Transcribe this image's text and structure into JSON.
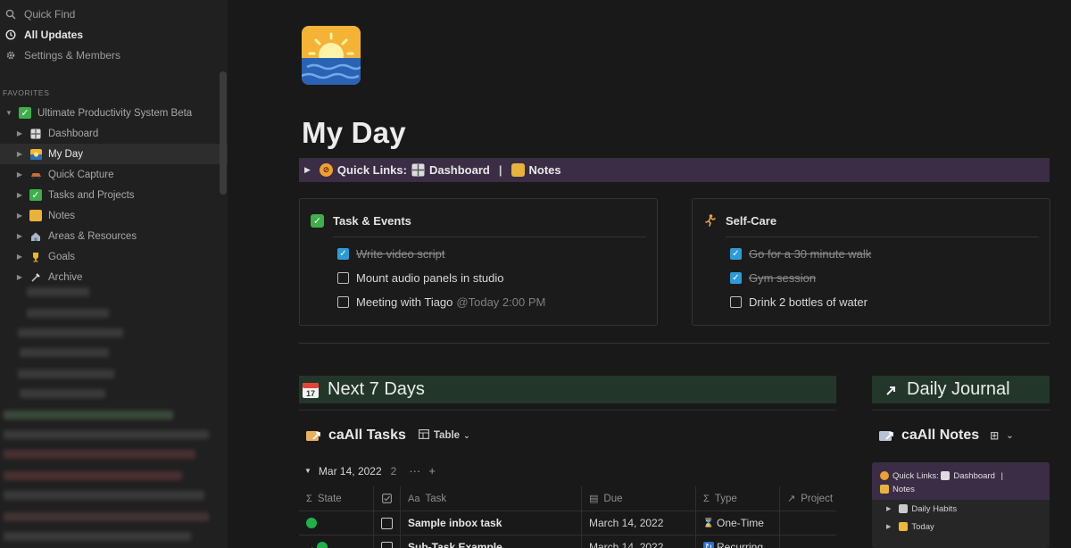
{
  "sidebar": {
    "top_items": [
      {
        "label": "Quick Find",
        "icon": "search-icon"
      },
      {
        "label": "All Updates",
        "icon": "clock-icon"
      },
      {
        "label": "Settings & Members",
        "icon": "gear-icon"
      }
    ],
    "favorites_label": "FAVORITES",
    "tree": [
      {
        "label": "Ultimate Productivity System Beta",
        "icon": "checkbox-emoji-icon",
        "level": 0,
        "expanded": true
      },
      {
        "label": "Dashboard",
        "icon": "grid-icon",
        "level": 1
      },
      {
        "label": "My Day",
        "icon": "sunrise-icon",
        "level": 1,
        "active": true
      },
      {
        "label": "Quick Capture",
        "icon": "car-icon",
        "level": 1
      },
      {
        "label": "Tasks and Projects",
        "icon": "checkbox-emoji-icon",
        "level": 1
      },
      {
        "label": "Notes",
        "icon": "notebook-icon",
        "level": 1
      },
      {
        "label": "Areas & Resources",
        "icon": "house-icon",
        "level": 1
      },
      {
        "label": "Goals",
        "icon": "trophy-icon",
        "level": 1
      },
      {
        "label": "Archive",
        "icon": "archive-icon",
        "level": 1
      }
    ]
  },
  "page": {
    "title": "My Day",
    "icon": "sunrise-over-water-icon",
    "quick_links": {
      "label": "Quick Links:",
      "links": [
        {
          "label": "Dashboard",
          "icon": "grid-icon"
        },
        {
          "label": "Notes",
          "icon": "notebook-icon"
        }
      ],
      "separator": "|"
    }
  },
  "cards": {
    "tasks": {
      "title": "Task & Events",
      "items": [
        {
          "text": "Write video script",
          "checked": true
        },
        {
          "text": "Mount audio panels in studio",
          "checked": false
        },
        {
          "text": "Meeting with Tiago",
          "mention": "@Today 2:00 PM",
          "checked": false
        }
      ]
    },
    "selfcare": {
      "title": "Self-Care",
      "items": [
        {
          "text": "Go for a 30 minute walk",
          "checked": true
        },
        {
          "text": "Gym session",
          "checked": true
        },
        {
          "text": "Drink 2 bottles of water",
          "checked": false
        }
      ]
    }
  },
  "next7": {
    "heading": "Next 7 Days",
    "db_title": "caAll Tasks",
    "view_label": "Table",
    "group": {
      "label": "Mar 14, 2022",
      "count": "2",
      "more": "···",
      "add": "+"
    },
    "columns": [
      "State",
      "",
      "Task",
      "Due",
      "Type",
      "Project"
    ],
    "rows": [
      {
        "task": "Sample inbox task",
        "due": "March 14, 2022",
        "type": "One-Time",
        "type_icon": "hourglass-icon"
      },
      {
        "task": "Sub-Task Example",
        "due": "March 14, 2022",
        "type": "Recurring",
        "type_icon": "repeat-icon"
      }
    ]
  },
  "journal": {
    "heading": "Daily Journal",
    "db_title": "caAll Notes",
    "side_card": {
      "ql_label": "Quick Links:",
      "ql_dashboard": "Dashboard",
      "ql_sep": "|",
      "ql_notes": "Notes",
      "items": [
        {
          "label": "Daily Habits",
          "icon": "calendar-icon"
        },
        {
          "label": "Today",
          "icon": "sunrise-icon"
        }
      ]
    }
  },
  "colors": {
    "sidebar_bg": "#202020",
    "main_bg": "#191919",
    "purple_callout": "#3a2d45",
    "green_heading": "#22372a",
    "checkbox_blue": "#2e9bd8",
    "state_green": "#1fb14a"
  }
}
